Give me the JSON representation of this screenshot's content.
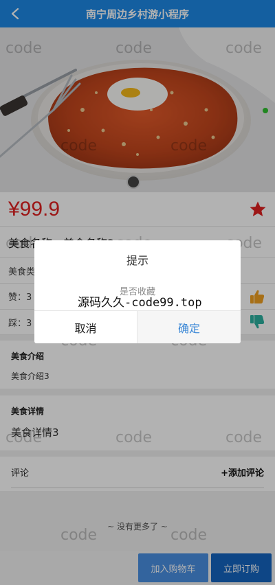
{
  "header": {
    "title": "南宁周边乡村游小程序",
    "back_icon": "chevron-left-icon"
  },
  "hero": {
    "image": "food-photo-pasta-with-egg",
    "carousel_dots": 1
  },
  "product": {
    "price": "¥99.9",
    "favorite_icon": "star-icon",
    "favorite_color": "#e02020",
    "name": "美食名称：美食名称3",
    "type": "美食类型：美食类型3",
    "like_label": "赞：3",
    "dislike_label": "踩：3",
    "like_icon_color": "#f0a020",
    "dislike_icon_color": "#2bb0a0"
  },
  "intro": {
    "title": "美食介绍",
    "body": "美食介绍3"
  },
  "detail": {
    "title": "美食详情",
    "body": "美食详情3"
  },
  "comments": {
    "label": "评论",
    "add_label": "+添加评论"
  },
  "footer_note": "~ 没有更多了 ~",
  "actions": {
    "cart_label": "加入购物车",
    "order_label": "立即订购",
    "cart_color": "#4a90e2",
    "order_color": "#1565c0"
  },
  "modal": {
    "title": "提示",
    "content": "是否收藏",
    "cancel_label": "取消",
    "confirm_label": "确定"
  },
  "watermark": {
    "text": "code",
    "center_text": "源码久久-code99.top"
  }
}
